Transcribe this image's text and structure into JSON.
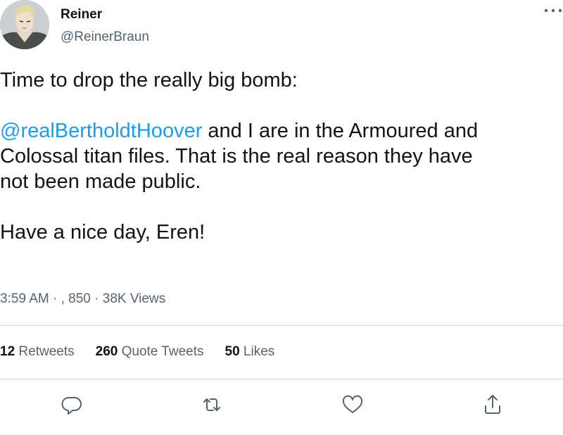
{
  "author": {
    "display_name": "Reiner",
    "handle": "@ReinerBraun",
    "avatar_icon": "anime-character-avatar"
  },
  "tweet": {
    "line1": "Time to drop the really big bomb:",
    "mention": "@realBertholdtHoover",
    "paragraph2_line1_rest": " and I are in the Armoured and",
    "paragraph2_line2": "Colossal titan files. That is the real reason they have",
    "paragraph2_line3": "not been made public.",
    "paragraph3": "Have a nice day, Eren!"
  },
  "meta": {
    "time": "3:59 AM",
    "separator1": " · , ",
    "date_fragment": "850",
    "separator2": " · ",
    "views_count": "38K",
    "views_label": " Views"
  },
  "stats": {
    "retweets_count": "12",
    "retweets_label": " Retweets",
    "quotes_count": "260",
    "quotes_label": " Quote Tweets",
    "likes_count": "50",
    "likes_label": " Likes"
  },
  "actions": [
    "reply-icon",
    "retweet-icon",
    "like-icon",
    "share-icon"
  ],
  "colors": {
    "text": "#0f1419",
    "secondary": "#536471",
    "link": "#1d9bf0",
    "divider": "#cfd9de"
  }
}
